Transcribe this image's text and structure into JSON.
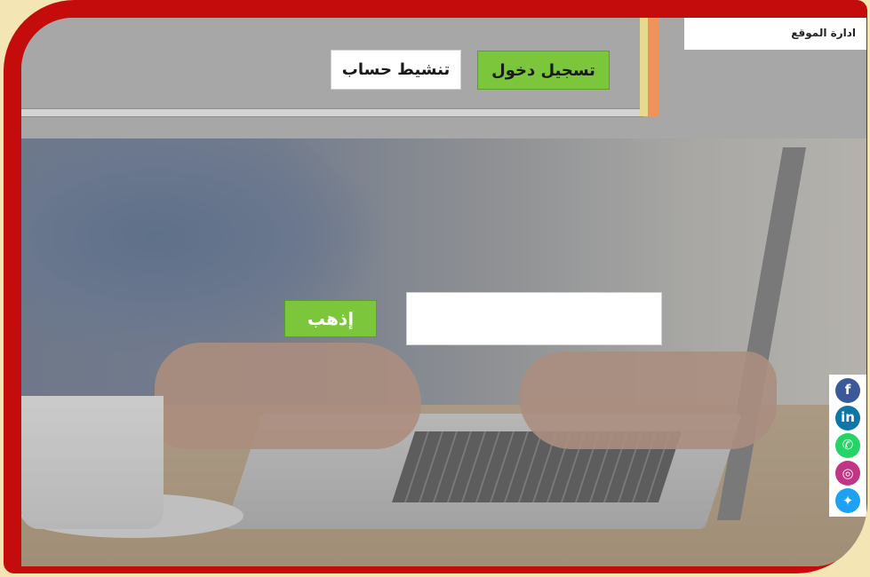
{
  "header": {
    "admin_label": "ادارة الموقع",
    "login_label": "تسجيل دخول",
    "activate_label": "تنشيط حساب"
  },
  "search": {
    "value": "",
    "placeholder": "",
    "go_label": "إذهب"
  },
  "social": [
    {
      "name": "facebook",
      "icon": "facebook-icon",
      "glyph": "f",
      "color": "#3b5998"
    },
    {
      "name": "linkedin",
      "icon": "linkedin-icon",
      "glyph": "in",
      "color": "#0e76a8"
    },
    {
      "name": "whatsapp",
      "icon": "whatsapp-icon",
      "glyph": "✆",
      "color": "#25d366"
    },
    {
      "name": "instagram",
      "icon": "instagram-icon",
      "glyph": "◎",
      "color": "#c13584"
    },
    {
      "name": "twitter",
      "icon": "twitter-icon",
      "glyph": "✦",
      "color": "#1da1f2"
    }
  ],
  "colors": {
    "frame": "#c40c0c",
    "frame_outer": "#f3e6b4",
    "header_bg": "#a7a7a7",
    "accent_green": "#7cc63b",
    "stripe_yellow": "#e7d98e",
    "stripe_orange": "#f0935a"
  }
}
